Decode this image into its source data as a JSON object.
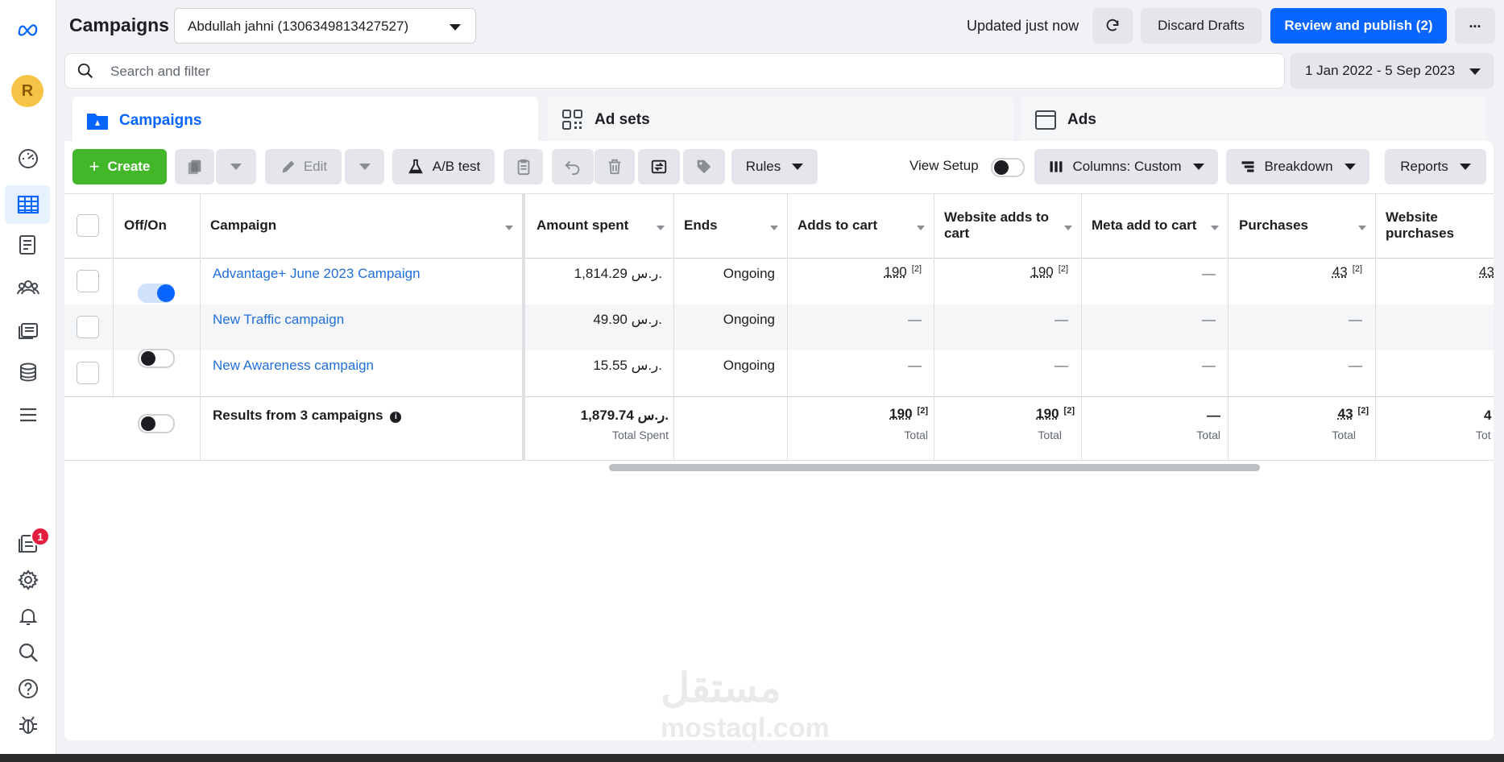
{
  "header": {
    "title": "Campaigns",
    "account": "Abdullah jahni (1306349813427527)",
    "updated": "Updated just now",
    "discard": "Discard Drafts",
    "publish": "Review and publish (2)",
    "more": "..."
  },
  "search": {
    "placeholder": "Search and filter"
  },
  "date_range": "1 Jan 2022 - 5 Sep 2023",
  "rail": {
    "avatar_letter": "R",
    "notification_count": "1"
  },
  "tabs": [
    {
      "label": "Campaigns",
      "icon": "folder-icon"
    },
    {
      "label": "Ad sets",
      "icon": "grid-icon"
    },
    {
      "label": "Ads",
      "icon": "ad-icon"
    }
  ],
  "toolbar": {
    "create": "Create",
    "edit": "Edit",
    "ab_test": "A/B test",
    "rules": "Rules",
    "view_setup": "View Setup",
    "columns": "Columns: Custom",
    "breakdown": "Breakdown",
    "reports": "Reports"
  },
  "table": {
    "headers": {
      "offon": "Off/On",
      "campaign": "Campaign",
      "amount": "Amount spent",
      "ends": "Ends",
      "adds": "Adds to cart",
      "web_adds": "Website adds to cart",
      "meta_adds": "Meta add to cart",
      "purchases": "Purchases",
      "web_purchases": "Website purchases"
    },
    "rows": [
      {
        "name": "Advantage+ June 2023 Campaign",
        "on": true,
        "amount": "1,814.29 ر.س.",
        "ends": "Ongoing",
        "adds": "190",
        "web_adds": "190",
        "meta_adds": "—",
        "purchases": "43",
        "web_purchases": "43"
      },
      {
        "name": "New Traffic campaign",
        "on": false,
        "amount": "49.90 ر.س.",
        "ends": "Ongoing",
        "adds": "—",
        "web_adds": "—",
        "meta_adds": "—",
        "purchases": "—",
        "web_purchases": ""
      },
      {
        "name": "New Awareness campaign",
        "on": false,
        "amount": "15.55 ر.س.",
        "ends": "Ongoing",
        "adds": "—",
        "web_adds": "—",
        "meta_adds": "—",
        "purchases": "—",
        "web_purchases": ""
      }
    ],
    "footnote": "[2]",
    "totals": {
      "label": "Results from 3 campaigns",
      "amount": "1,879.74 ر.س.",
      "amount_sub": "Total Spent",
      "adds": "190",
      "web_adds": "190",
      "meta_adds": "—",
      "purchases": "43",
      "web_purchases": "4",
      "sub": "Total",
      "sub_cut": "Tot"
    }
  },
  "watermark": {
    "arabic": "مستقل",
    "latin": "mostaql.com"
  },
  "colors": {
    "brand_blue": "#0866ff",
    "create_green": "#42b72a",
    "link_blue": "#216fdb"
  }
}
